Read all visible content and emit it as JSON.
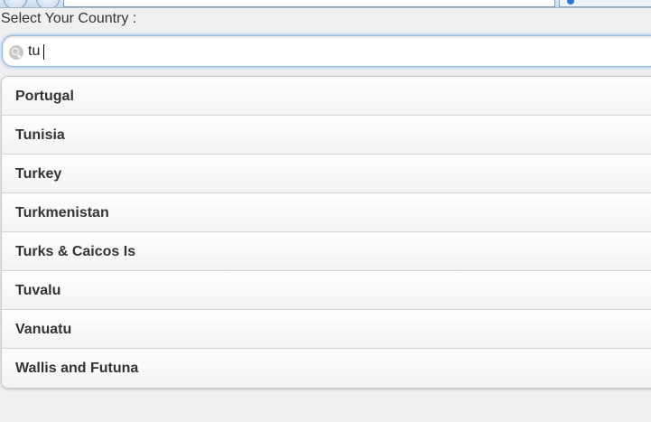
{
  "page": {
    "prompt": "Select Your Country :"
  },
  "search": {
    "value": "tu",
    "placeholder": ""
  },
  "results": [
    "Portugal",
    "Tunisia",
    "Turkey",
    "Turkmenistan",
    "Turks & Caicos Is",
    "Tuvalu",
    "Vanuatu",
    "Wallis and Futuna"
  ],
  "colors": {
    "focus_glow": "#3891e9",
    "text": "#333333",
    "background": "#f0f0f0"
  },
  "icons": {
    "search": "search-icon",
    "back": "back-arrow-icon",
    "forward": "forward-arrow-icon",
    "tab": "globe-icon"
  }
}
